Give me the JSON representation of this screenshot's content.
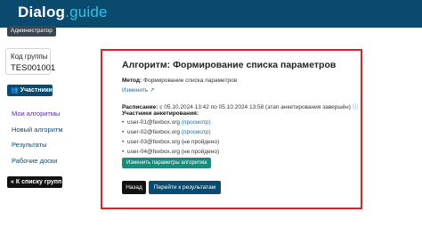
{
  "header": {
    "logo_part1": "Dialog",
    "logo_part2": ".guide",
    "role": "Администратор"
  },
  "sidebar": {
    "group_label": "Код группы",
    "group_code": "TES001001",
    "participants_button": "Участники",
    "nav": [
      {
        "label": "Мои алгоритмы",
        "active": true
      },
      {
        "label": "Новый алгоритм",
        "active": false
      },
      {
        "label": "Результаты",
        "active": false
      },
      {
        "label": "Рабочие доски",
        "active": false
      }
    ],
    "back_to_groups": "К списку групп"
  },
  "panel": {
    "title": "Алгоритм: Формирование списка параметров",
    "method_label": "Метод:",
    "method_value": "Формирование списка параметров",
    "edit_link": "Изменить",
    "schedule_label": "Расписание:",
    "schedule_value": "с 05.10.2024 13:42 по 05.10.2024 13:58 (этап анкетирования завершён)",
    "participants_label": "Участники анкетирования:",
    "participants": [
      {
        "email": "user-01@fexbox.org",
        "status": "(просмотр)",
        "link": true
      },
      {
        "email": "user-02@fexbox.org",
        "status": "(просмотр)",
        "link": true
      },
      {
        "email": "user-03@fexbox.org",
        "status": "(не пройдено)",
        "link": false
      },
      {
        "email": "user-04@fexbox.org",
        "status": "(не пройдено)",
        "link": false
      }
    ],
    "change_params_button": "Изменить параметры алгоритма",
    "back_button": "Назад",
    "results_button": "Перейти к результатам"
  },
  "colors": {
    "brand": "#0b4a6f",
    "accent_logo": "#2cc4e6",
    "highlight_border": "#e02020",
    "teal_button": "#1a8a7a",
    "link": "#1a6fb0",
    "active_nav": "#5b2aa8"
  }
}
